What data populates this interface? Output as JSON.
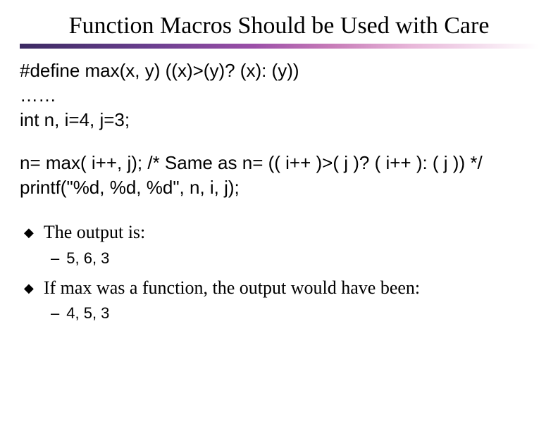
{
  "title": "Function Macros Should be Used with Care",
  "code": {
    "l1": "#define max(x, y) ((x)>(y)? (x): (y))",
    "l2": "……",
    "l3": "int n, i=4, j=3;",
    "l4": "n= max( i++, j);   /* Same as n= (( i++ )>( j )? ( i++ ): ( j )) */",
    "l5": "printf(\"%d, %d, %d\", n, i, j);"
  },
  "bullets": {
    "b1": "The output is:",
    "s1": "5, 6, 3",
    "b2": "If max was a function, the output would have been:",
    "s2": "4, 5, 3"
  }
}
